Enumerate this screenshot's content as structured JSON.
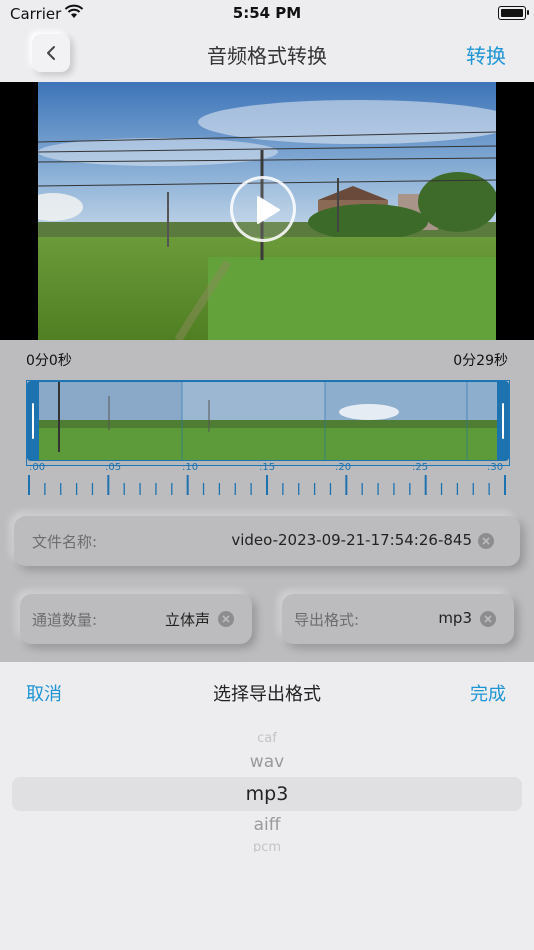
{
  "status_bar": {
    "carrier": "Carrier",
    "time": "5:54 PM"
  },
  "nav": {
    "title": "音频格式转换",
    "action_label": "转换"
  },
  "video": {
    "icon": "play-icon"
  },
  "trimmer": {
    "start_time": "0分0秒",
    "end_time": "0分29秒",
    "tick_labels": [
      ":00",
      ":05",
      ":10",
      ":15",
      ":20",
      ":25",
      ":30"
    ]
  },
  "fields": {
    "file_name": {
      "label": "文件名称:",
      "value": "video-2023-09-21-17:54:26-845"
    },
    "channels": {
      "label": "通道数量:",
      "value": "立体声"
    },
    "format": {
      "label": "导出格式:",
      "value": "mp3"
    }
  },
  "picker": {
    "cancel_label": "取消",
    "title": "选择导出格式",
    "done_label": "完成",
    "options": [
      "caf",
      "wav",
      "mp3",
      "aiff",
      "pcm"
    ],
    "selected": "mp3"
  },
  "colors": {
    "accent": "#1e95d4",
    "timeline": "#1d72b0"
  }
}
